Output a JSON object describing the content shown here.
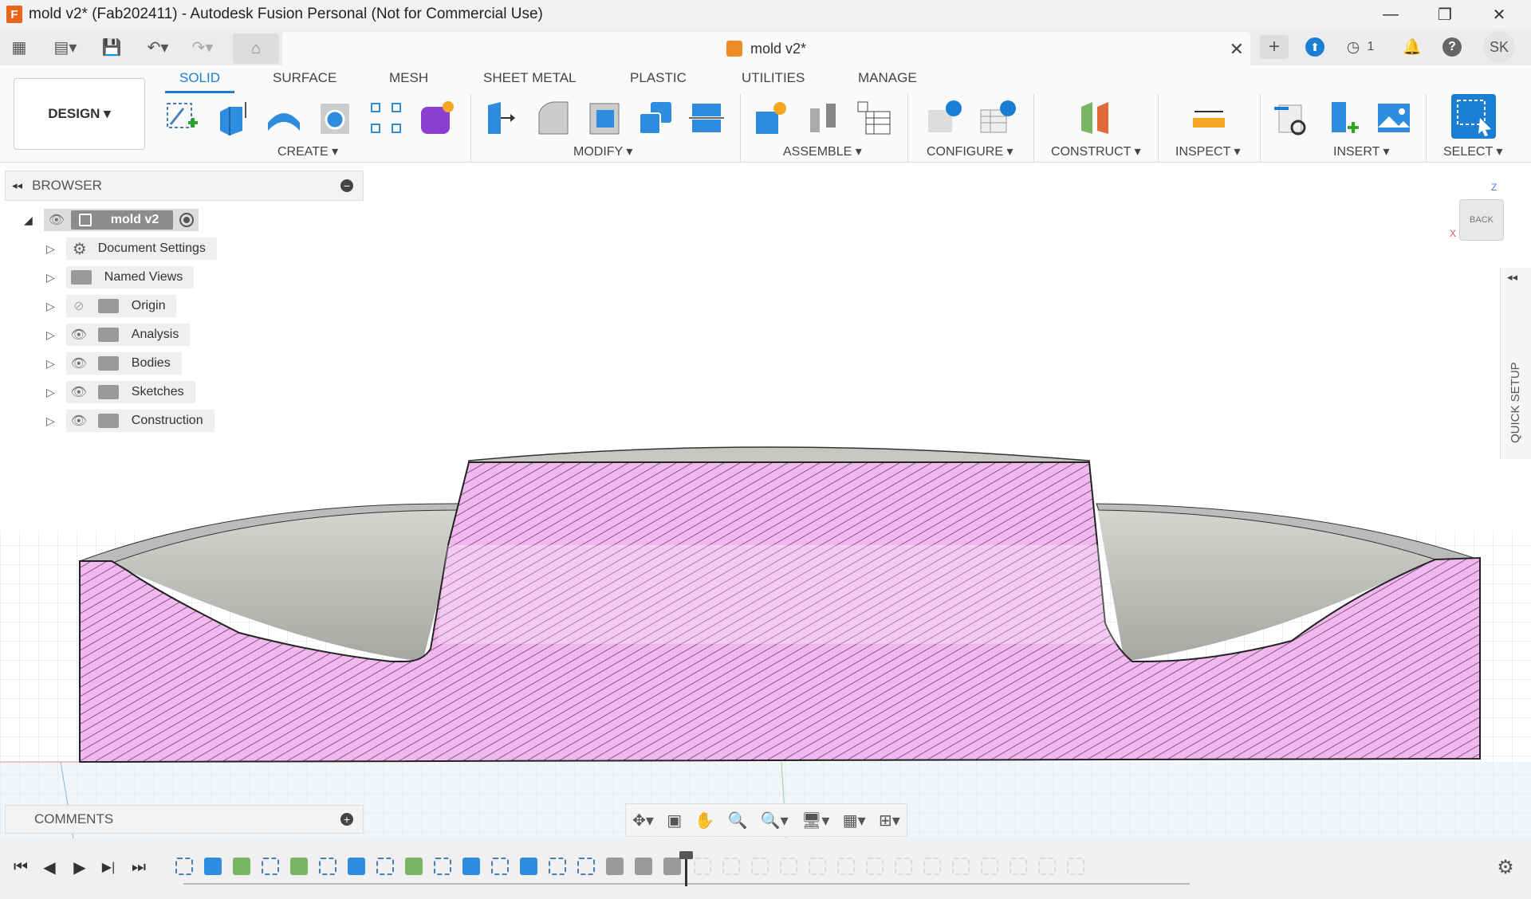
{
  "window": {
    "title": "mold v2* (Fab202411) - Autodesk Fusion Personal (Not for Commercial Use)",
    "app_icon_letter": "F",
    "minimize": "—",
    "restore": "❐",
    "close": "✕"
  },
  "quick_access": {
    "grid_icon": "▦",
    "file_icon": "▤▾",
    "save_icon": "💾",
    "undo_icon": "↶▾",
    "redo_icon": "↷▾",
    "home_icon": "⌂"
  },
  "document_tab": {
    "label": "mold v2*",
    "close": "✕"
  },
  "top_right": {
    "new_tab": "+",
    "extensions_icon": "⬆",
    "jobs_icon": "◷",
    "jobs_count": "1",
    "notifications_icon": "🔔",
    "help_icon": "?",
    "user_initials": "SK"
  },
  "workspace": {
    "label": "DESIGN ▾"
  },
  "ribbon_tabs": [
    {
      "label": "SOLID",
      "active": true
    },
    {
      "label": "SURFACE",
      "active": false
    },
    {
      "label": "MESH",
      "active": false
    },
    {
      "label": "SHEET METAL",
      "active": false
    },
    {
      "label": "PLASTIC",
      "active": false
    },
    {
      "label": "UTILITIES",
      "active": false
    },
    {
      "label": "MANAGE",
      "active": false
    }
  ],
  "ribbon_groups": {
    "create": "CREATE ▾",
    "modify": "MODIFY ▾",
    "assemble": "ASSEMBLE ▾",
    "configure": "CONFIGURE ▾",
    "construct": "CONSTRUCT ▾",
    "inspect": "INSPECT ▾",
    "insert": "INSERT ▾",
    "select": "SELECT ▾"
  },
  "browser": {
    "collapse_icon": "◂◂",
    "title": "BROWSER",
    "minus_icon": "−",
    "root": "mold v2",
    "items": [
      {
        "label": "Document Settings"
      },
      {
        "label": "Named Views"
      },
      {
        "label": "Origin"
      },
      {
        "label": "Analysis"
      },
      {
        "label": "Bodies"
      },
      {
        "label": "Sketches"
      },
      {
        "label": "Construction"
      }
    ]
  },
  "viewcube": {
    "face": "BACK",
    "z": "Z",
    "x": "X"
  },
  "quick_setup": {
    "label": "QUICK SETUP",
    "collapse_icon": "◂◂"
  },
  "comments": {
    "title": "COMMENTS",
    "add_icon": "+"
  },
  "nav_bar": {
    "orbit_icon": "✥▾",
    "look_icon": "▣",
    "pan_icon": "✋",
    "zoom_icon": "🔍",
    "fit_icon": "🔍▾",
    "display_icon": "🖥▾",
    "grid_icon": "▦▾",
    "viewports_icon": "⊞▾"
  },
  "timeline": {
    "first": "⏮",
    "prev": "◀",
    "play": "▶",
    "next": "▶|",
    "last": "⏭",
    "settings_icon": "⚙"
  },
  "colors": {
    "accent": "#1a7fd4",
    "section_fill": "#f0b8ee",
    "body_gray": "#c8c6c2",
    "grid": "#d5e4ee"
  }
}
